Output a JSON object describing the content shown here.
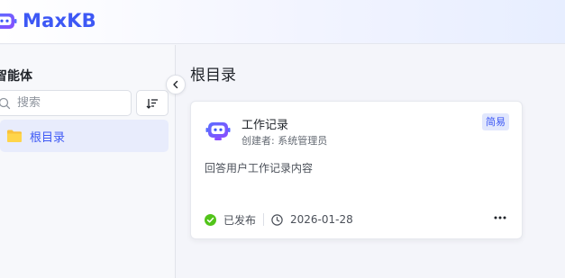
{
  "header": {
    "app_name": "MaxKB",
    "brand_color": "#3d58f5"
  },
  "sidebar": {
    "title": "智能体",
    "search": {
      "placeholder": "搜索",
      "value": ""
    },
    "sort_icon": "sort-icon",
    "tree": [
      {
        "label": "根目录",
        "icon": "folder-icon",
        "selected": true
      }
    ]
  },
  "main": {
    "title": "根目录",
    "cards": [
      {
        "title": "工作记录",
        "creator": "创建者: 系统管理员",
        "badge": "简易",
        "description": "回答用户工作记录内容",
        "status": "已发布",
        "status_color": "#52c41a",
        "date": "2026-01-28",
        "avatar_icon": "robot-icon"
      }
    ]
  }
}
